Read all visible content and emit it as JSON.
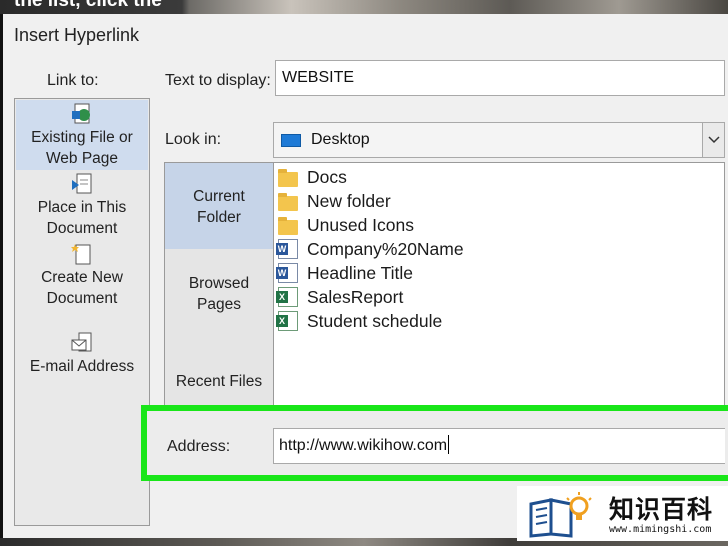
{
  "background": {
    "caption": "the list, click the"
  },
  "dialog": {
    "title": "Insert Hyperlink"
  },
  "link_to": {
    "label": "Link to:",
    "items": [
      {
        "line1": "Existing File or",
        "line2": "Web Page",
        "icon": "existing-file-icon",
        "selected": true
      },
      {
        "line1": "Place in This",
        "line2": "Document",
        "icon": "place-in-document-icon",
        "selected": false
      },
      {
        "line1": "Create New",
        "line2": "Document",
        "icon": "new-document-icon",
        "selected": false
      },
      {
        "line1": "E-mail Address",
        "line2": "",
        "icon": "email-icon",
        "selected": false
      }
    ]
  },
  "text_to_display": {
    "label": "Text to display:",
    "value": "WEBSITE"
  },
  "look_in": {
    "label": "Look in:",
    "value": "Desktop",
    "icon": "desktop-icon"
  },
  "nav": {
    "items": [
      {
        "line1": "Current",
        "line2": "Folder",
        "selected": true
      },
      {
        "line1": "Browsed",
        "line2": "Pages",
        "selected": false
      },
      {
        "line1": "Recent Files",
        "line2": "",
        "selected": false
      }
    ]
  },
  "files": [
    {
      "name": "Docs",
      "type": "folder"
    },
    {
      "name": "New folder",
      "type": "folder"
    },
    {
      "name": "Unused Icons",
      "type": "folder"
    },
    {
      "name": "Company%20Name",
      "type": "word"
    },
    {
      "name": "Headline Title",
      "type": "word"
    },
    {
      "name": "SalesReport",
      "type": "excel"
    },
    {
      "name": "Student schedule",
      "type": "excel"
    }
  ],
  "address": {
    "label": "Address:",
    "value": "http://www.wikihow.com"
  },
  "highlight_color": "#19e619",
  "watermark": {
    "brand": "知识百科",
    "site": "www.mimingshi.com"
  }
}
